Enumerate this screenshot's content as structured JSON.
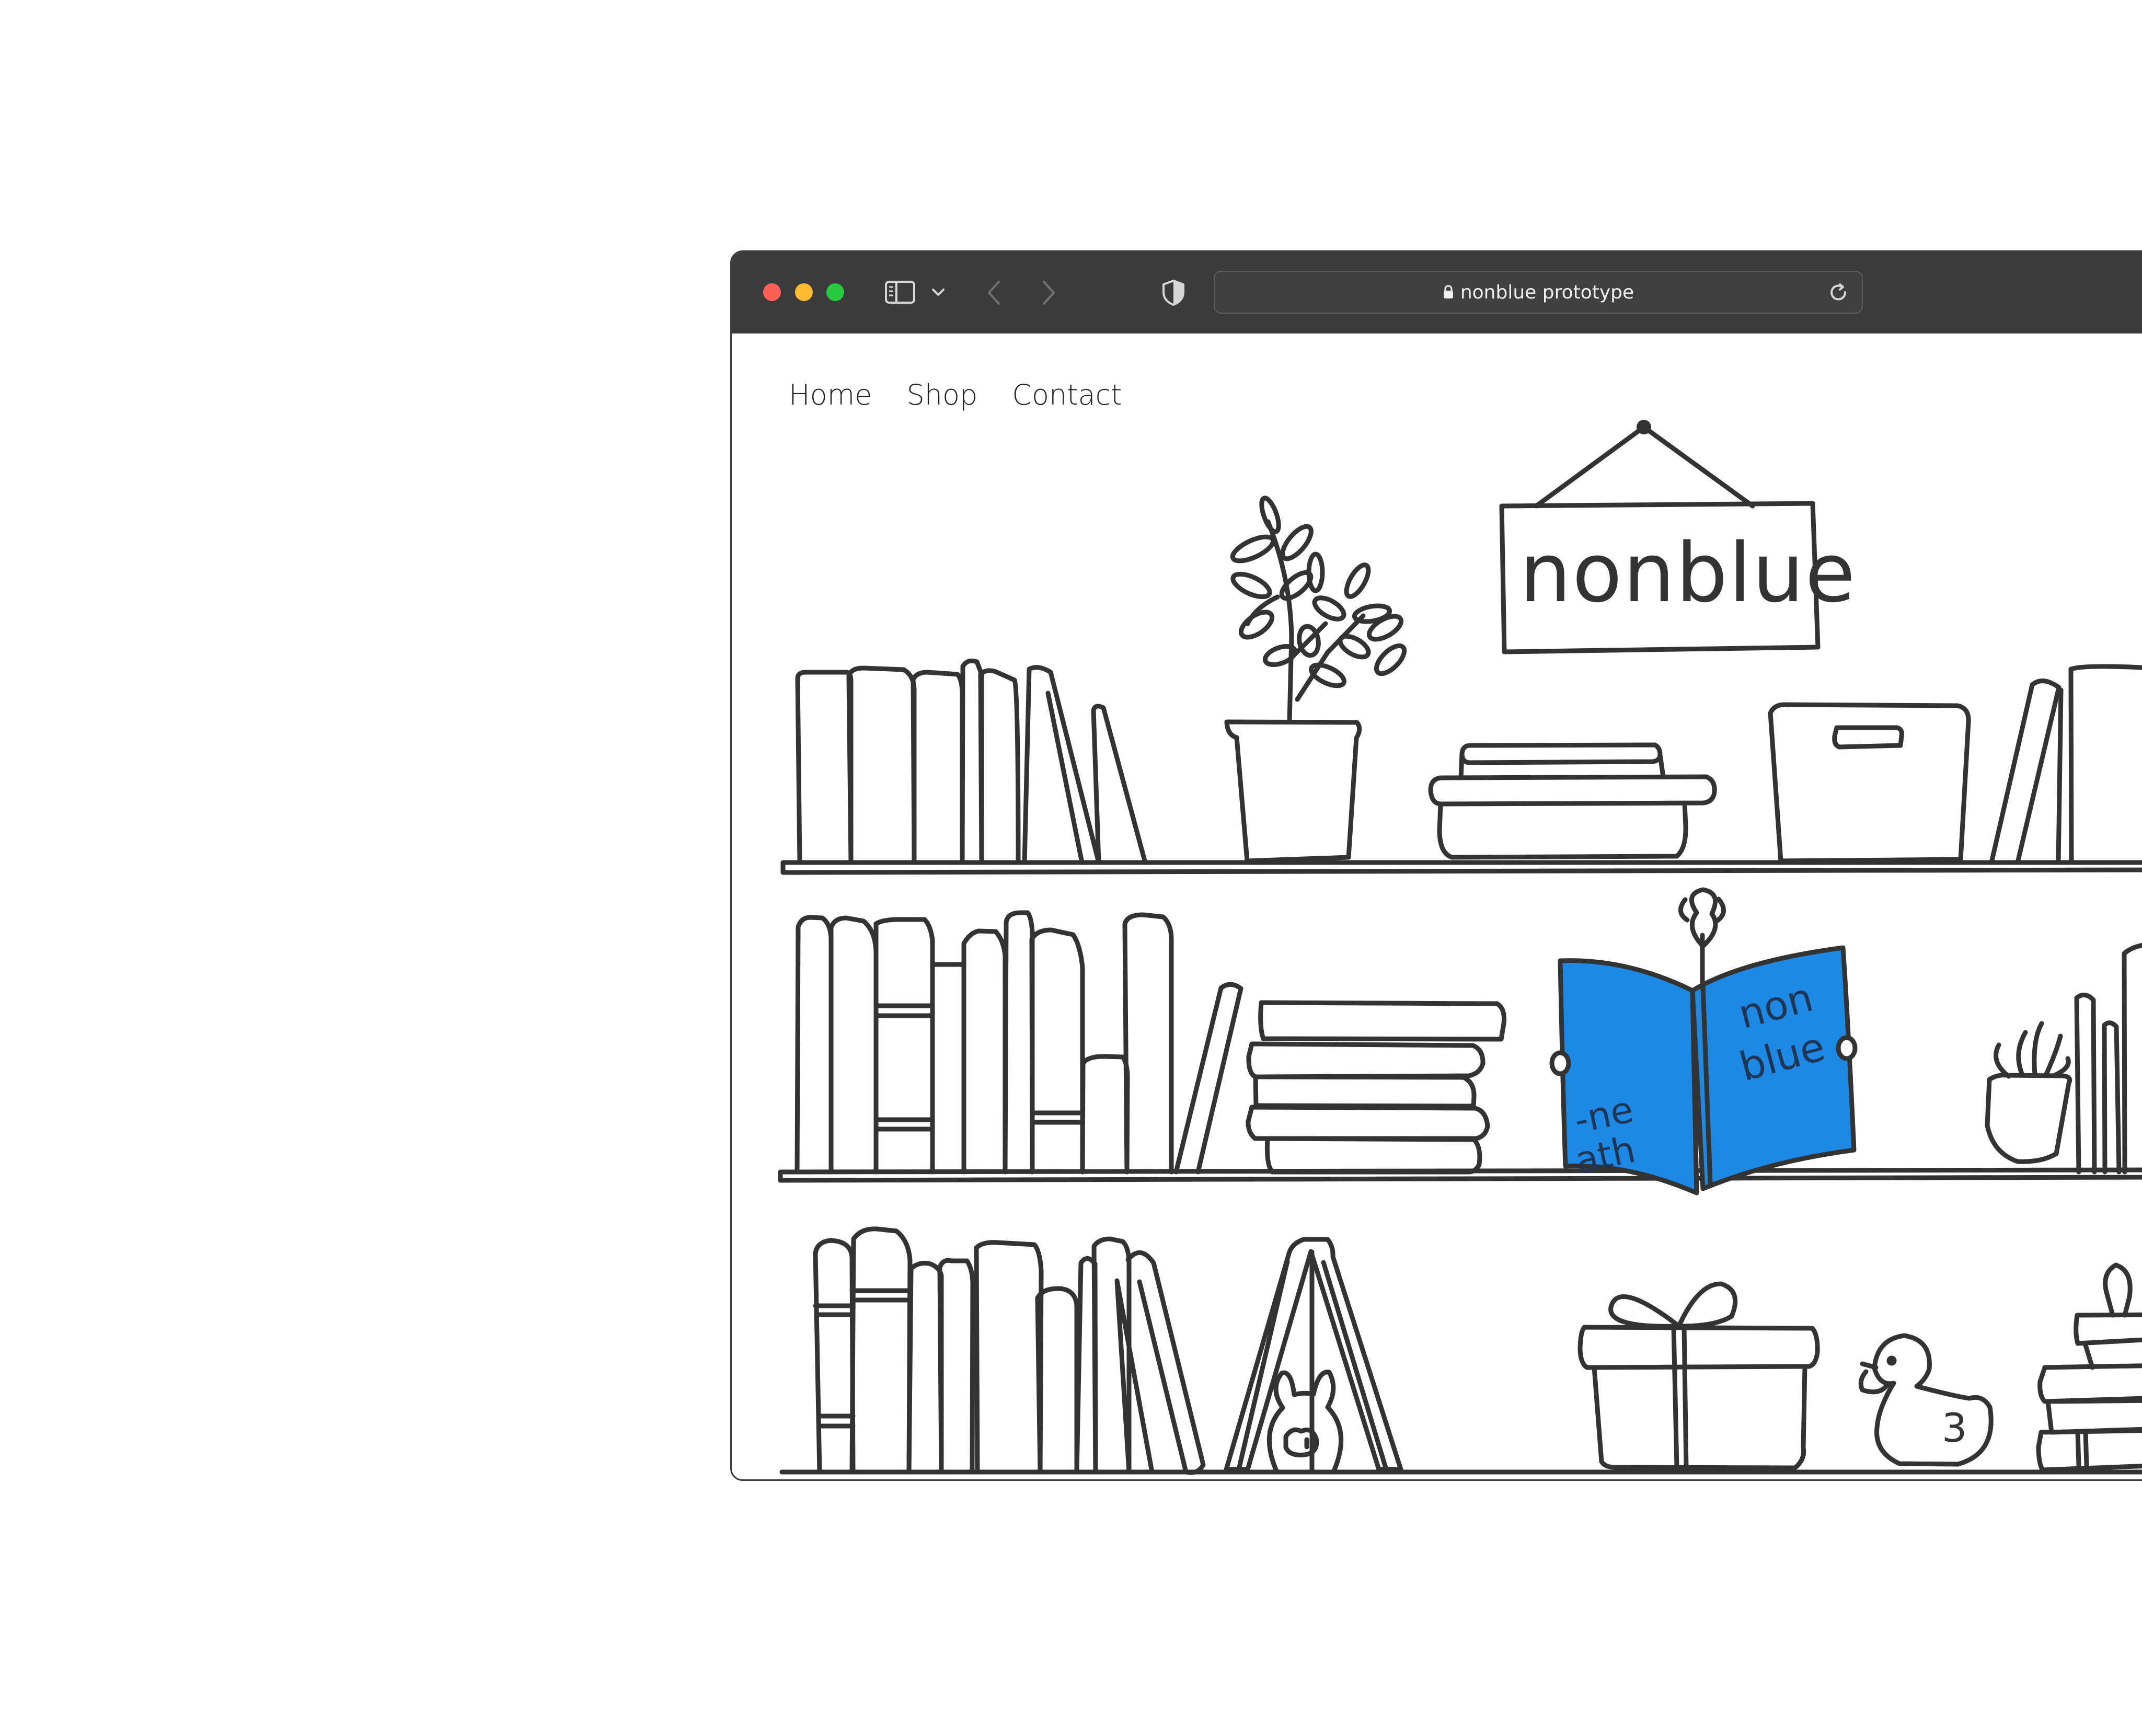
{
  "browser": {
    "address_text": "nonblue prototype",
    "icons": [
      "sidebar-icon",
      "chevron-down-icon",
      "back-arrow-icon",
      "forward-arrow-icon",
      "privacy-shield-icon",
      "lock-icon",
      "reload-icon"
    ]
  },
  "nav": {
    "items": [
      "Home",
      "Shop",
      "Contact"
    ]
  },
  "illustration": {
    "sign_text": "nonblue",
    "book_cover_text": "non\nblue",
    "book_spine_text": "-ne\nath",
    "duck_number": "3"
  },
  "colors": {
    "toolbar": "#3a3b3a",
    "page_background": "#ffffff",
    "ink": "#333333",
    "accent_blue": "#1e88e5"
  }
}
